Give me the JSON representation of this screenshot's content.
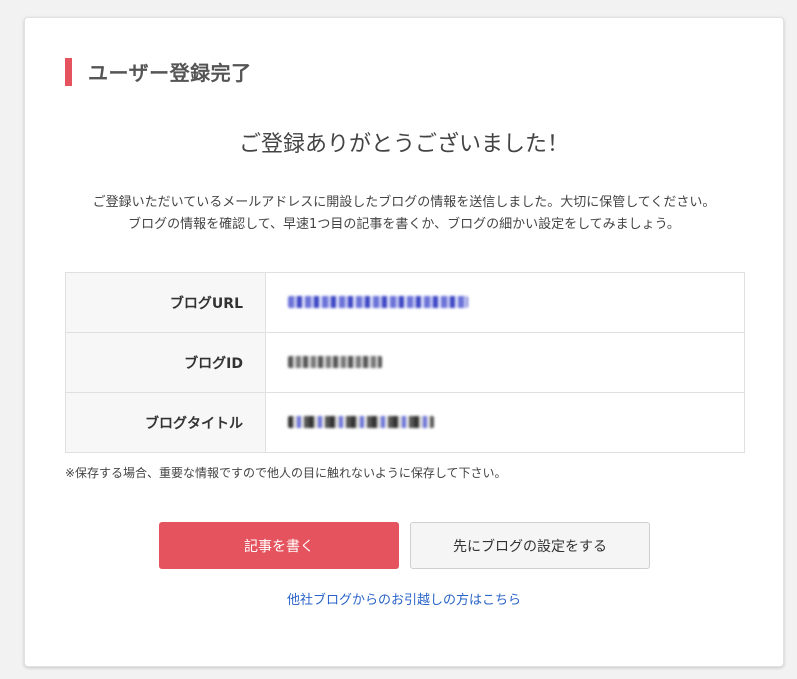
{
  "page": {
    "title": "ユーザー登録完了",
    "thanks": "ご登録ありがとうございました！",
    "description_line1": "ご登録いただいているメールアドレスに開設したブログの情報を送信しました。大切に保管してください。",
    "description_line2": "ブログの情報を確認して、早速1つ目の記事を書くか、ブログの細かい設定をしてみましょう。"
  },
  "info_table": {
    "rows": [
      {
        "label": "ブログURL"
      },
      {
        "label": "ブログID"
      },
      {
        "label": "ブログタイトル"
      }
    ]
  },
  "note": "※保存する場合、重要な情報ですので他人の目に触れないように保存して下さい。",
  "buttons": {
    "write_post": "記事を書く",
    "blog_settings": "先にブログの設定をする"
  },
  "link": {
    "migrate": "他社ブログからのお引越しの方はこちら"
  },
  "colors": {
    "accent": "#e5535e",
    "link": "#2a64c8",
    "background": "#f2f2f2"
  }
}
